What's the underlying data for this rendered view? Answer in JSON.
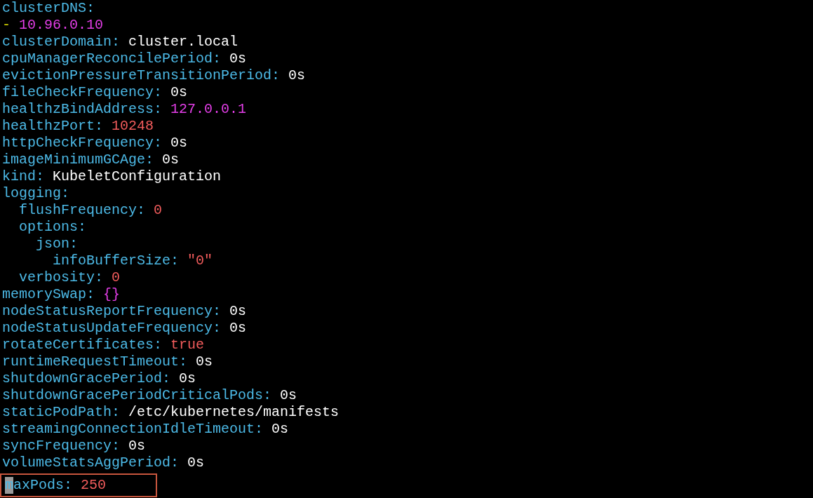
{
  "entries": [
    {
      "key": "clusterDNS:",
      "children": [
        {
          "marker": "-",
          "value": "10.96.0.10",
          "kind": "ip"
        }
      ]
    },
    {
      "key": "clusterDomain:",
      "value": "cluster.local",
      "kind": "plain"
    },
    {
      "key": "cpuManagerReconcilePeriod:",
      "value": "0s",
      "kind": "plain"
    },
    {
      "key": "evictionPressureTransitionPeriod:",
      "value": "0s",
      "kind": "plain"
    },
    {
      "key": "fileCheckFrequency:",
      "value": "0s",
      "kind": "plain"
    },
    {
      "key": "healthzBindAddress:",
      "value": "127.0.0.1",
      "kind": "ip"
    },
    {
      "key": "healthzPort:",
      "value": "10248",
      "kind": "number"
    },
    {
      "key": "httpCheckFrequency:",
      "value": "0s",
      "kind": "plain"
    },
    {
      "key": "imageMinimumGCAge:",
      "value": "0s",
      "kind": "plain"
    },
    {
      "key": "kind:",
      "value": "KubeletConfiguration",
      "kind": "plain"
    },
    {
      "key": "logging:",
      "children": [
        {
          "key": "flushFrequency:",
          "value": "0",
          "kind": "number"
        },
        {
          "key": "options:",
          "children": [
            {
              "key": "json:",
              "children": [
                {
                  "key": "infoBufferSize:",
                  "value": "\"0\"",
                  "kind": "string"
                }
              ]
            }
          ]
        },
        {
          "key": "verbosity:",
          "value": "0",
          "kind": "number"
        }
      ]
    },
    {
      "key": "memorySwap:",
      "value": "{}",
      "kind": "map"
    },
    {
      "key": "nodeStatusReportFrequency:",
      "value": "0s",
      "kind": "plain"
    },
    {
      "key": "nodeStatusUpdateFrequency:",
      "value": "0s",
      "kind": "plain"
    },
    {
      "key": "rotateCertificates:",
      "value": "true",
      "kind": "boolean"
    },
    {
      "key": "runtimeRequestTimeout:",
      "value": "0s",
      "kind": "plain"
    },
    {
      "key": "shutdownGracePeriod:",
      "value": "0s",
      "kind": "plain"
    },
    {
      "key": "shutdownGracePeriodCriticalPods:",
      "value": "0s",
      "kind": "plain"
    },
    {
      "key": "staticPodPath:",
      "value": "/etc/kubernetes/manifests",
      "kind": "plain"
    },
    {
      "key": "streamingConnectionIdleTimeout:",
      "value": "0s",
      "kind": "plain"
    },
    {
      "key": "syncFrequency:",
      "value": "0s",
      "kind": "plain"
    },
    {
      "key": "volumeStatsAggPeriod:",
      "value": "0s",
      "kind": "plain"
    },
    {
      "key": "maxPods:",
      "value": "250",
      "kind": "number",
      "highlighted": true,
      "cursor": true
    }
  ]
}
